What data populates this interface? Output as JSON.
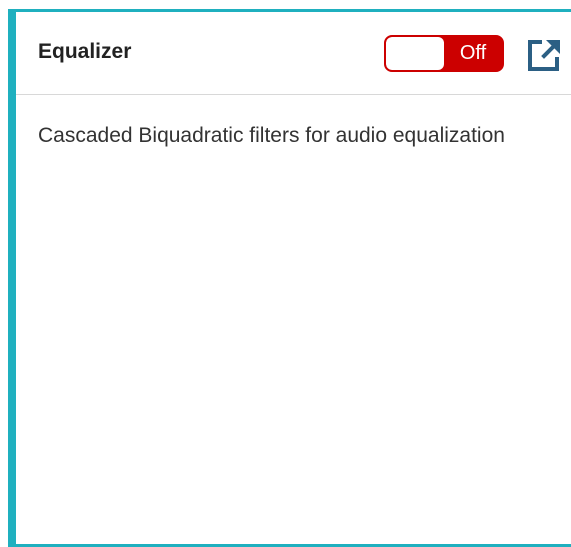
{
  "panel": {
    "title": "Equalizer",
    "toggle": {
      "state_label": "Off",
      "is_on": false,
      "active_color": "#cc0000"
    },
    "popout_icon": "external-link-icon",
    "description": "Cascaded Biquadratic filters for audio equalization",
    "accent_color": "#1fb0bf"
  }
}
